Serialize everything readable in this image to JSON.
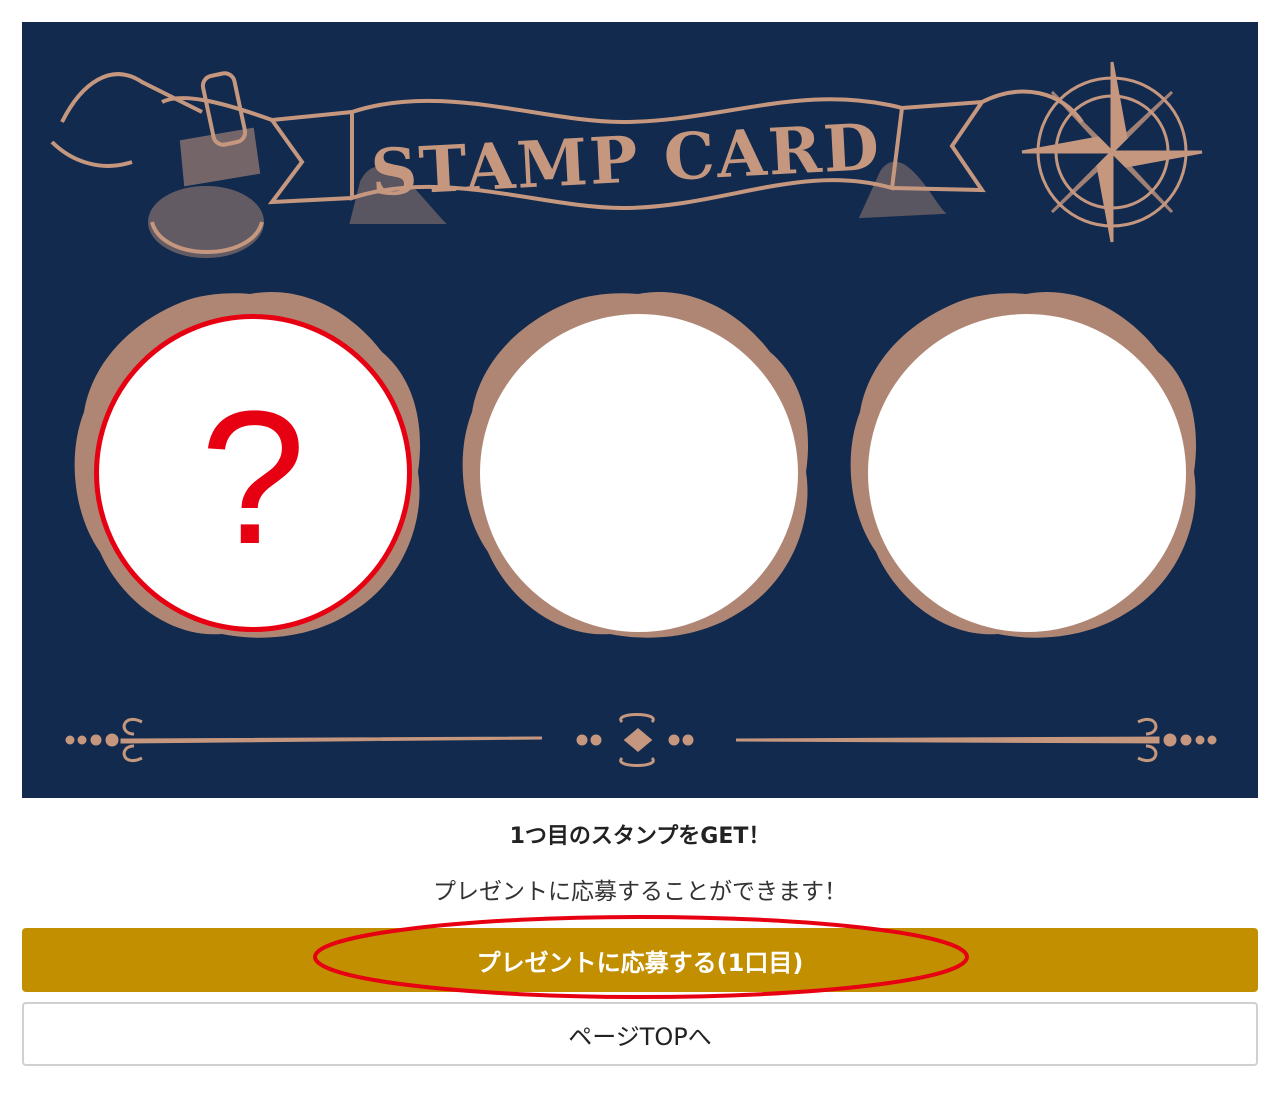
{
  "card": {
    "title": "STAMP CARD",
    "background_color": "#112a4e",
    "ornament_color": "#c6977f",
    "stamps": [
      {
        "slot": 1,
        "state": "active",
        "mark": "?"
      },
      {
        "slot": 2,
        "state": "empty",
        "mark": ""
      },
      {
        "slot": 3,
        "state": "empty",
        "mark": ""
      }
    ],
    "highlight_color": "#e60012"
  },
  "message": {
    "headline": "1つ目のスタンプをGET！",
    "subtext": "プレゼントに応募することができます！"
  },
  "actions": {
    "apply_label": "プレゼントに応募する(1口目)",
    "apply_color": "#c18f00",
    "top_label": "ページTOPへ"
  }
}
